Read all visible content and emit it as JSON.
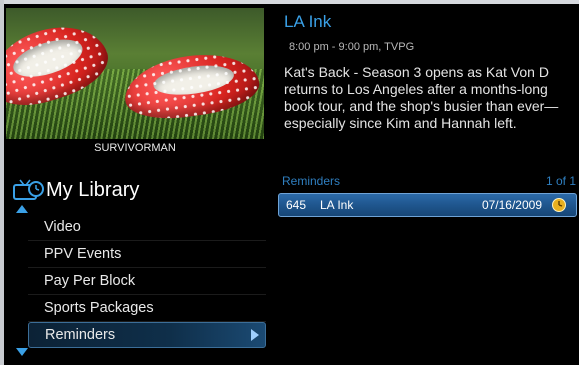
{
  "program": {
    "thumbnail_caption": "SURVIVORMAN",
    "title": "LA Ink",
    "time": "8:00 pm - 9:00 pm, TVPG",
    "description": "Kat's Back - Season 3 opens as Kat Von D returns to Los Angeles after a months-long book tour, and the shop's busier than ever—especially since Kim and Hannah left."
  },
  "library": {
    "title": "My Library",
    "icon": "tv-clock-icon",
    "items": [
      {
        "label": "Video",
        "selected": false
      },
      {
        "label": "PPV Events",
        "selected": false
      },
      {
        "label": "Pay Per Block",
        "selected": false
      },
      {
        "label": "Sports Packages",
        "selected": false
      },
      {
        "label": "Reminders",
        "selected": true
      }
    ]
  },
  "reminders": {
    "header": "Reminders",
    "count": "1 of 1",
    "rows": [
      {
        "channel": "645",
        "name": "LA Ink",
        "date": "07/16/2009",
        "icon": "clock-icon"
      }
    ]
  },
  "colors": {
    "accent": "#3aa0e6",
    "selection": "#1f568e",
    "reminder_icon": "#e8b020"
  }
}
